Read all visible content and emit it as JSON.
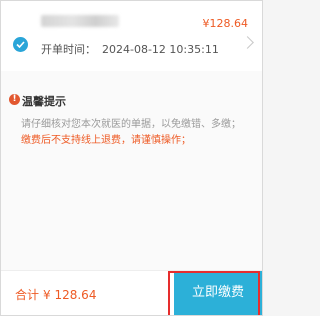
{
  "bill": {
    "amount": "¥128.64",
    "open_time_label": "开单时间：",
    "open_time_value": "2024-08-12 10:35:11"
  },
  "notice": {
    "title": "温馨提示",
    "line1": "请仔细核对您本次就医的单据，以免缴错、多缴；",
    "line2": "缴费后不支持线上退费，请谨慎操作；"
  },
  "footer": {
    "total_label": "合计",
    "total_amount": "¥ 128.64",
    "pay_button": "立即缴费"
  },
  "colors": {
    "accent": "#2cb0d8",
    "price": "#ee5a24",
    "highlight": "#e62d2d"
  }
}
